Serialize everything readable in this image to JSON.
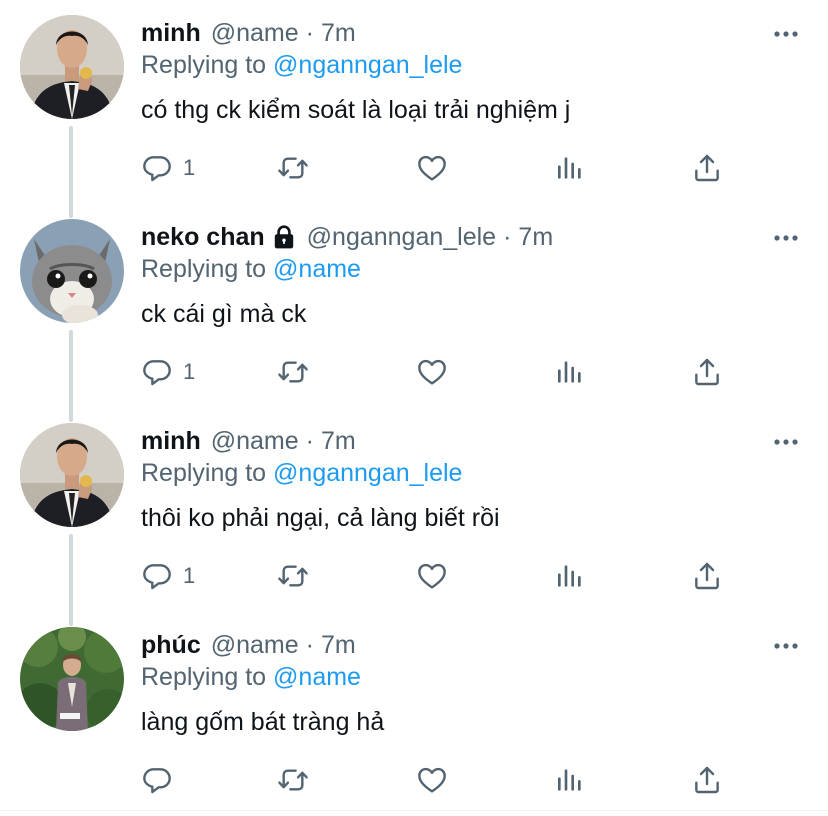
{
  "colors": {
    "link": "#1d9bf0",
    "secondary": "#536471",
    "text": "#0f1419",
    "thread_line": "#cfd9de"
  },
  "tweets": [
    {
      "display_name": "minh",
      "protected": false,
      "handle": "@name",
      "separator": "·",
      "time": "7m",
      "reply_label": "Replying to",
      "reply_to": "@nganngan_lele",
      "text": "có thg ck kiểm soát là loại trải nghiệm j",
      "reply_count": "1",
      "avatar_icon": "man-in-suit-avatar"
    },
    {
      "display_name": "neko chan",
      "protected": true,
      "handle": "@nganngan_lele",
      "separator": "·",
      "time": "7m",
      "reply_label": "Replying to",
      "reply_to": "@name",
      "text": "ck cái gì mà ck",
      "reply_count": "1",
      "avatar_icon": "cat-avatar"
    },
    {
      "display_name": "minh",
      "protected": false,
      "handle": "@name",
      "separator": "·",
      "time": "7m",
      "reply_label": "Replying to",
      "reply_to": "@nganngan_lele",
      "text": "thôi ko phải ngại, cả làng biết rồi",
      "reply_count": "1",
      "avatar_icon": "man-in-suit-avatar"
    },
    {
      "display_name": "phúc",
      "protected": false,
      "handle": "@name",
      "separator": "·",
      "time": "7m",
      "reply_label": "Replying to",
      "reply_to": "@name",
      "text": "làng gốm bát tràng hả",
      "reply_count": "",
      "avatar_icon": "person-in-garden-avatar"
    }
  ],
  "icons": {
    "more": "more-options-icon",
    "reply": "reply-icon",
    "retweet": "retweet-icon",
    "like": "heart-icon",
    "analytics": "analytics-icon",
    "share": "share-icon",
    "lock": "lock-icon"
  }
}
